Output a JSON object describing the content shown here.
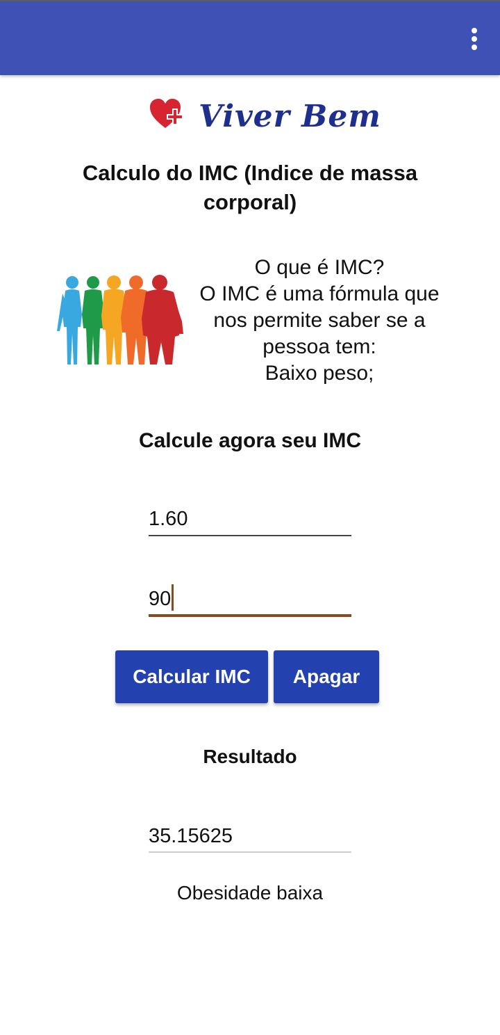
{
  "app": {
    "logo_text": "Viver Bem",
    "accent_color": "#3f51b5",
    "button_color": "#2441b0"
  },
  "header": {
    "title": "Calculo do IMC (Indice de massa corporal)"
  },
  "info": {
    "lines": [
      "O que é IMC?",
      "O IMC é uma fórmula que",
      "nos permite saber se a",
      "pessoa tem:",
      "Baixo peso;"
    ]
  },
  "form": {
    "subtitle": "Calcule agora seu IMC",
    "height_value": "1.60",
    "weight_value": "90",
    "calculate_label": "Calcular IMC",
    "clear_label": "Apagar"
  },
  "result": {
    "label": "Resultado",
    "value": "35.15625",
    "classification": "Obesidade baixa"
  },
  "icons": {
    "menu": "more-vert-icon",
    "logo": "heart-cross-icon",
    "illustration": "body-silhouettes-illustration"
  }
}
